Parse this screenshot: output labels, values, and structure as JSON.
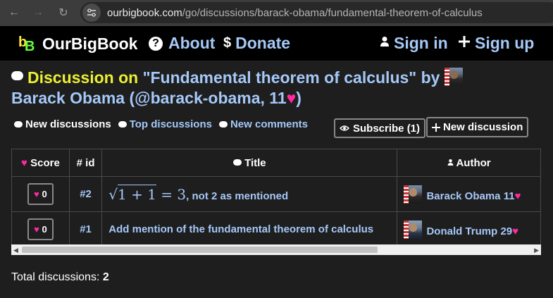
{
  "browser": {
    "url_domain": "ourbigbook.com",
    "url_path": "/go/discussions/barack-obama/fundamental-theorem-of-calculus"
  },
  "header": {
    "brand": "OurBigBook",
    "about": "About",
    "donate_symbol": "$",
    "donate": "Donate",
    "sign_in": "Sign in",
    "sign_up": "Sign up"
  },
  "discussion": {
    "label": "Discussion on",
    "article_title": "\"Fundamental theorem of calculus\"",
    "by": "by",
    "author_line": "Barack Obama (@barack-obama, 11",
    "author_line_end": ")"
  },
  "tabs": {
    "new_discussions": "New discussions",
    "top_discussions": "Top discussions",
    "new_comments": "New comments",
    "subscribe": "Subscribe (1)",
    "new_discussion": "New discussion"
  },
  "table": {
    "headers": {
      "score": "Score",
      "id": "# id",
      "title": "Title",
      "author": "Author"
    },
    "rows": [
      {
        "score": "0",
        "id": "#2",
        "title_math_radicand": "1 + 1",
        "title_math_rest": " = 3",
        "title_text": ", not 2 as mentioned",
        "author": "Barack Obama 11"
      },
      {
        "score": "0",
        "id": "#1",
        "title_text": "Add mention of the fundamental theorem of calculus",
        "author": "Donald Trump 29"
      }
    ]
  },
  "footer": {
    "total_label": "Total discussions:",
    "total_value": "2"
  },
  "colors": {
    "link": "#a5c8f7",
    "label_yellow": "#ebf032",
    "heart": "#ff2aa0"
  }
}
